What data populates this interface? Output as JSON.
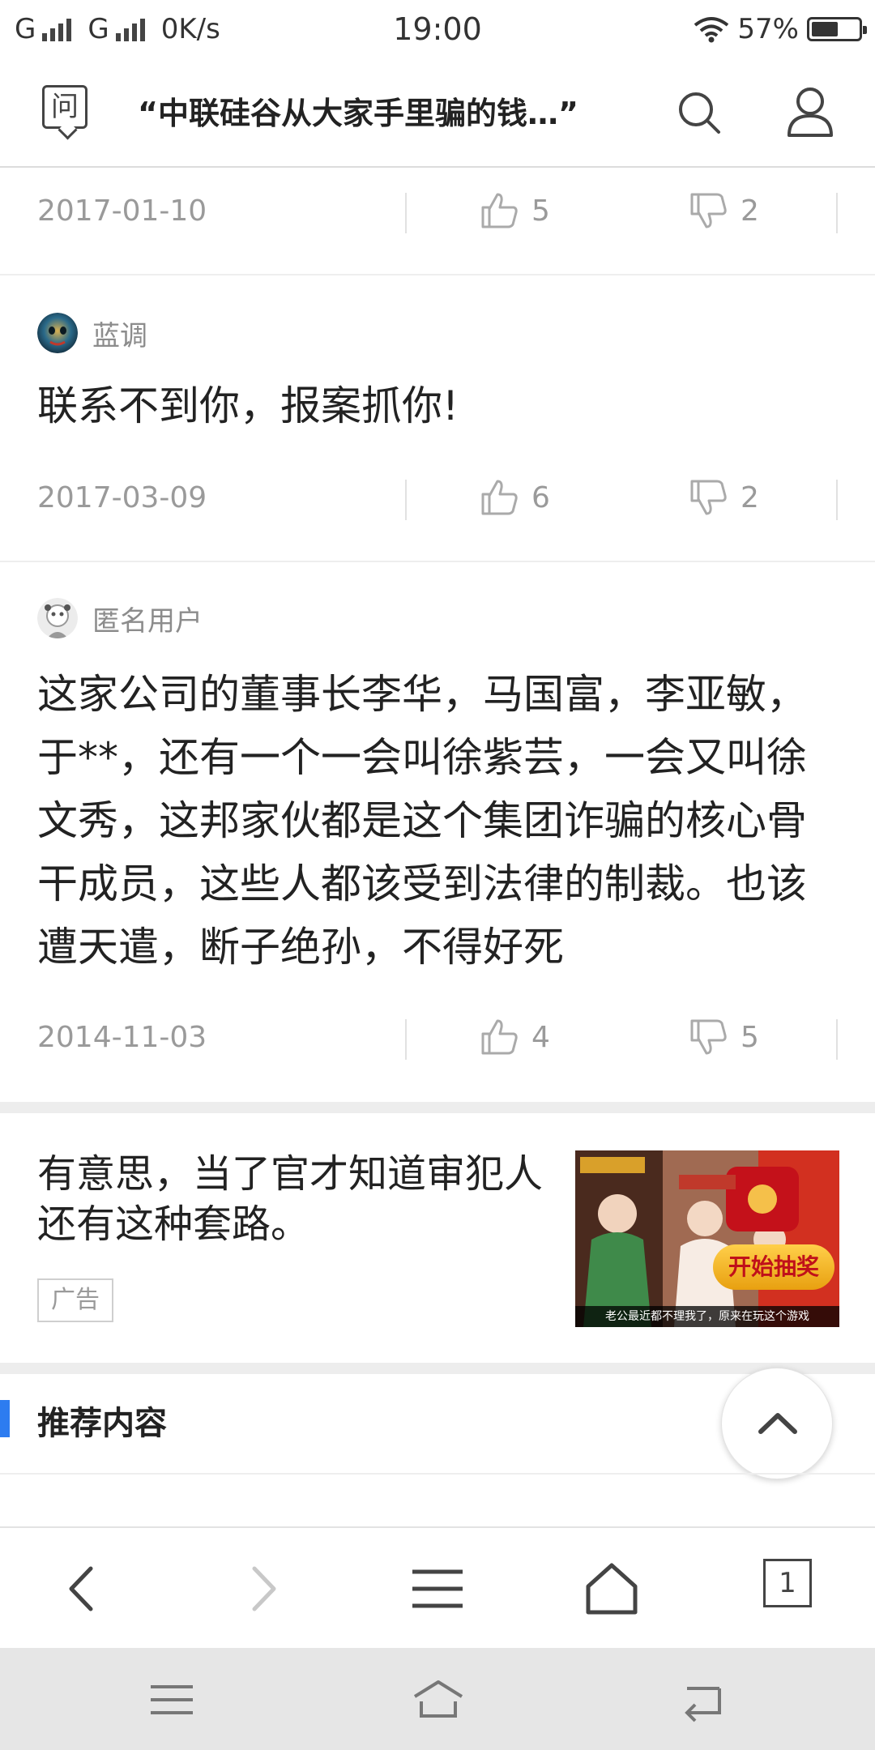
{
  "status_bar": {
    "carrier1": "G",
    "carrier2": "G",
    "speed": "0K/s",
    "time": "19:00",
    "battery": "57%",
    "battery_level": 0.57
  },
  "header": {
    "ask_icon_char": "问",
    "title": "“中联硅谷从大家手里骗的钱…”"
  },
  "comments": [
    {
      "date": "2017-01-10",
      "likes": "5",
      "dislikes": "2"
    },
    {
      "user": "蓝调",
      "text": "联系不到你，报案抓你!",
      "date": "2017-03-09",
      "likes": "6",
      "dislikes": "2"
    },
    {
      "user": "匿名用户",
      "text": "这家公司的董事长李华，马国富，李亚敏，于**，还有一个一会叫徐紫芸，一会又叫徐文秀，这邦家伙都是这个集团诈骗的核心骨干成员，这些人都该受到法律的制裁。也该遭天遣，断子绝孙，不得好死",
      "date": "2014-11-03",
      "likes": "4",
      "dislikes": "5"
    }
  ],
  "ad": {
    "text": "有意思，当了官才知道审犯人还有这种套路。",
    "badge": "广告",
    "image_button": "开始抽奖",
    "image_caption": "老公最近都不理我了，原来在玩这个游戏"
  },
  "recommended": {
    "title": "推荐内容"
  },
  "browser_bar": {
    "tab_count": "1"
  },
  "colors": {
    "accent": "#2d7cf0",
    "muted_text": "#9a9a9a",
    "divider": "#eeeeee"
  }
}
